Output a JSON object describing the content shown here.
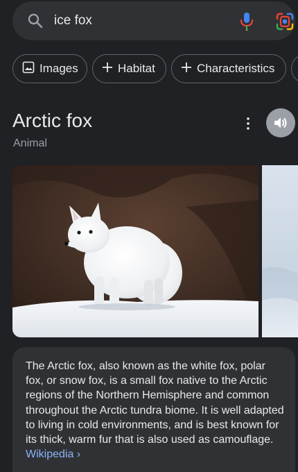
{
  "search": {
    "query": "ice fox"
  },
  "chips": [
    {
      "label": "Images",
      "icon": "image-icon"
    },
    {
      "label": "Habitat",
      "icon": "plus-icon"
    },
    {
      "label": "Characteristics",
      "icon": "plus-icon"
    }
  ],
  "knowledge_panel": {
    "title": "Arctic fox",
    "subtitle": "Animal",
    "description": "The Arctic fox, also known as the white fox, polar fox, or snow fox, is a small fox native to the Arctic regions of the Northern Hemisphere and common throughout the Arctic tundra biome. It is well adapted to living in cold environments, and is best known for its thick, warm fur that is also used as camouflage.",
    "source_label": "Wikipedia",
    "source_chevron": "›"
  },
  "colors": {
    "background": "#202124",
    "surface": "#303134",
    "text": "#e8eaed",
    "muted": "#9aa0a6",
    "link": "#8ab4f8"
  }
}
